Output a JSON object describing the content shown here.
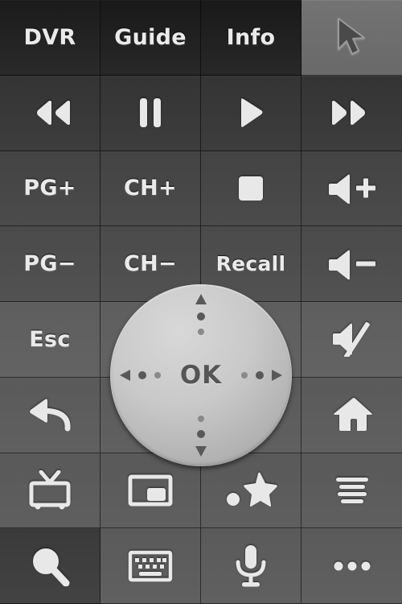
{
  "app": {
    "title": "TV Remote Control",
    "accent_red": "#d8372f",
    "active_cell_color": "#6b6b6b"
  },
  "grid": {
    "columns": 4,
    "rows": 8,
    "buttons": [
      {
        "id": "dvr",
        "label": "DVR",
        "icon": null,
        "row": 1,
        "col": 1,
        "active": false
      },
      {
        "id": "guide",
        "label": "Guide",
        "icon": null,
        "row": 1,
        "col": 2,
        "active": false
      },
      {
        "id": "info",
        "label": "Info",
        "icon": null,
        "row": 1,
        "col": 3,
        "active": false
      },
      {
        "id": "cursor",
        "label": "",
        "icon": "cursor-icon",
        "row": 1,
        "col": 4,
        "active": true
      },
      {
        "id": "rewind",
        "label": "",
        "icon": "rewind-icon",
        "row": 2,
        "col": 1,
        "active": false
      },
      {
        "id": "pause",
        "label": "",
        "icon": "pause-icon",
        "row": 2,
        "col": 2,
        "active": false
      },
      {
        "id": "play",
        "label": "",
        "icon": "play-icon",
        "row": 2,
        "col": 3,
        "active": false
      },
      {
        "id": "forward",
        "label": "",
        "icon": "fast-forward-icon",
        "row": 2,
        "col": 4,
        "active": false
      },
      {
        "id": "page-up",
        "label": "PG+",
        "icon": null,
        "row": 3,
        "col": 1,
        "active": false
      },
      {
        "id": "channel-up",
        "label": "CH+",
        "icon": null,
        "row": 3,
        "col": 2,
        "active": false
      },
      {
        "id": "stop",
        "label": "",
        "icon": "stop-icon",
        "row": 3,
        "col": 3,
        "active": false
      },
      {
        "id": "volume-up",
        "label": "",
        "icon": "volume-up-icon",
        "row": 3,
        "col": 4,
        "active": false
      },
      {
        "id": "page-down",
        "label": "PG−",
        "icon": null,
        "row": 4,
        "col": 1,
        "active": false
      },
      {
        "id": "channel-down",
        "label": "CH−",
        "icon": null,
        "row": 4,
        "col": 2,
        "active": false
      },
      {
        "id": "recall",
        "label": "Recall",
        "icon": null,
        "row": 4,
        "col": 3,
        "active": false
      },
      {
        "id": "volume-down",
        "label": "",
        "icon": "volume-down-icon",
        "row": 4,
        "col": 4,
        "active": false
      },
      {
        "id": "escape",
        "label": "Esc",
        "icon": null,
        "row": 5,
        "col": 1,
        "active": false
      },
      {
        "id": "dpad-left-cell",
        "label": "",
        "icon": null,
        "row": 5,
        "col": 2,
        "active": false
      },
      {
        "id": "dpad-right-cell",
        "label": "",
        "icon": null,
        "row": 5,
        "col": 3,
        "active": false
      },
      {
        "id": "mute",
        "label": "",
        "icon": "mute-icon",
        "row": 5,
        "col": 4,
        "active": false
      },
      {
        "id": "back",
        "label": "",
        "icon": "back-arrow-icon",
        "row": 6,
        "col": 1,
        "active": false
      },
      {
        "id": "dpad-lower-left",
        "label": "",
        "icon": null,
        "row": 6,
        "col": 2,
        "active": false
      },
      {
        "id": "dpad-lower-right",
        "label": "",
        "icon": null,
        "row": 6,
        "col": 3,
        "active": false
      },
      {
        "id": "home",
        "label": "",
        "icon": "home-icon",
        "row": 6,
        "col": 4,
        "active": false
      },
      {
        "id": "tv",
        "label": "",
        "icon": "tv-icon",
        "row": 7,
        "col": 1,
        "active": false
      },
      {
        "id": "picture-in-picture",
        "label": "",
        "icon": "pip-icon",
        "row": 7,
        "col": 2,
        "active": false
      },
      {
        "id": "favorite",
        "label": "",
        "icon": "star-record-icon",
        "row": 7,
        "col": 3,
        "active": false
      },
      {
        "id": "menu",
        "label": "",
        "icon": "menu-list-icon",
        "row": 7,
        "col": 4,
        "active": false
      },
      {
        "id": "search",
        "label": "",
        "icon": "search-icon",
        "row": 8,
        "col": 1,
        "active": false
      },
      {
        "id": "keyboard",
        "label": "",
        "icon": "keyboard-icon",
        "row": 8,
        "col": 2,
        "active": false
      },
      {
        "id": "microphone",
        "label": "",
        "icon": "microphone-icon",
        "row": 8,
        "col": 3,
        "active": false
      },
      {
        "id": "more",
        "label": "",
        "icon": "more-dots-icon",
        "row": 8,
        "col": 4,
        "active": false
      }
    ]
  },
  "dpad": {
    "ok_label": "OK",
    "directions": [
      "up",
      "right",
      "down",
      "left"
    ],
    "dot_count_per_direction": 2
  }
}
